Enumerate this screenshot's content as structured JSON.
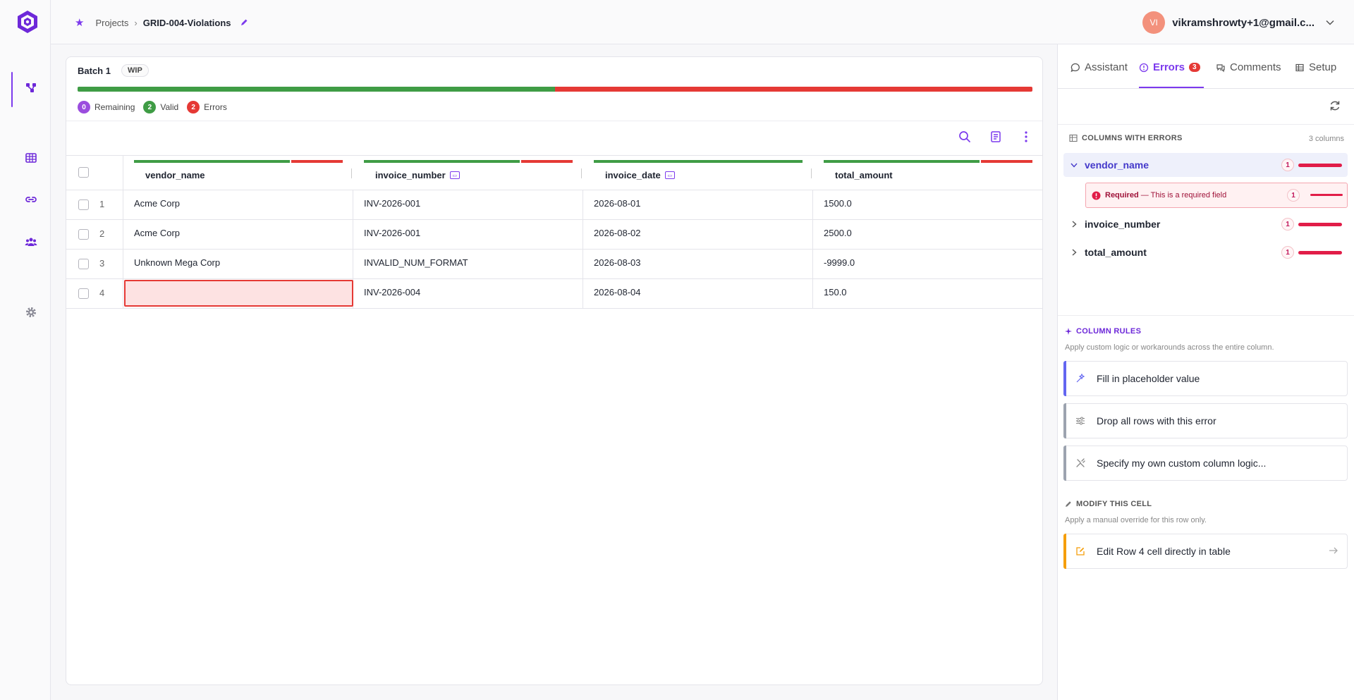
{
  "header": {
    "breadcrumb_root": "Projects",
    "breadcrumb_current": "GRID-004-Violations",
    "user_initials": "VI",
    "user_email": "vikramshrowty+1@gmail.c..."
  },
  "batch": {
    "title": "Batch 1",
    "status": "WIP",
    "progress_valid_fraction": 0.5,
    "stats": {
      "remaining_count": "0",
      "remaining_label": "Remaining",
      "valid_count": "2",
      "valid_label": "Valid",
      "errors_count": "2",
      "errors_label": "Errors"
    }
  },
  "table": {
    "columns": [
      {
        "name": "vendor_name",
        "valid_fraction": 0.75
      },
      {
        "name": "invoice_number",
        "valid_fraction": 0.75
      },
      {
        "name": "invoice_date",
        "valid_fraction": 1.0
      },
      {
        "name": "total_amount",
        "valid_fraction": 0.75
      }
    ],
    "rows": [
      {
        "num": "1",
        "vendor_name": "Acme Corp",
        "invoice_number": "INV-2026-001",
        "invoice_date": "2026-08-01",
        "total_amount": "1500.0"
      },
      {
        "num": "2",
        "vendor_name": "Acme Corp",
        "invoice_number": "INV-2026-001",
        "invoice_date": "2026-08-02",
        "total_amount": "2500.0"
      },
      {
        "num": "3",
        "vendor_name": "Unknown Mega Corp",
        "invoice_number": "INVALID_NUM_FORMAT",
        "invoice_date": "2026-08-03",
        "total_amount": "-9999.0"
      },
      {
        "num": "4",
        "vendor_name": "",
        "invoice_number": "INV-2026-004",
        "invoice_date": "2026-08-04",
        "total_amount": "150.0"
      }
    ]
  },
  "panel": {
    "tabs": {
      "assistant": "Assistant",
      "errors": "Errors",
      "errors_count": "3",
      "comments": "Comments",
      "setup": "Setup"
    },
    "columns_with_errors": {
      "title": "COLUMNS WITH ERRORS",
      "count_label": "3 columns",
      "items": [
        {
          "name": "vendor_name",
          "count": "1"
        },
        {
          "name": "invoice_number",
          "count": "1"
        },
        {
          "name": "total_amount",
          "count": "1"
        }
      ],
      "required_title": "Required",
      "required_desc": "— This is a required field",
      "required_count": "1"
    },
    "column_rules": {
      "title": "COLUMN RULES",
      "subtitle": "Apply custom logic or workarounds across the entire column.",
      "items": [
        {
          "label": "Fill in placeholder value"
        },
        {
          "label": "Drop all rows with this error"
        },
        {
          "label": "Specify my own custom column logic..."
        }
      ]
    },
    "modify_cell": {
      "title": "MODIFY THIS CELL",
      "subtitle": "Apply a manual override for this row only.",
      "action_label": "Edit Row 4 cell directly in table"
    }
  },
  "colors": {
    "accent": "#7c3aed",
    "valid": "#3f9c45",
    "error": "#e53935",
    "warning": "#f59e0b"
  }
}
